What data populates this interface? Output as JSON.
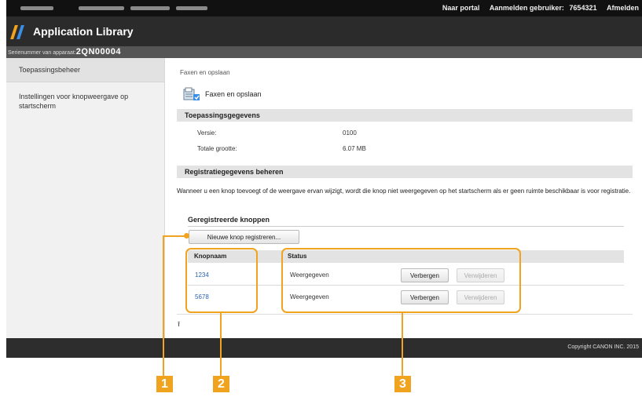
{
  "topbar": {
    "portal_link": "Naar portal",
    "login_user_label": "Aanmelden gebruiker:",
    "login_user_value": "7654321",
    "logout_link": "Afmelden"
  },
  "app": {
    "title": "Application Library"
  },
  "serial": {
    "label": "Serienummer van apparaat:",
    "value": "2QN00004"
  },
  "sidebar": {
    "items": [
      {
        "label": "Toepassingsbeheer"
      },
      {
        "label": "Instellingen voor knopweergave op startscherm"
      }
    ]
  },
  "main": {
    "breadcrumb": "Faxen en opslaan",
    "page_title": "Faxen en opslaan",
    "app_info": {
      "header": "Toepassingsgegevens",
      "version_label": "Versie:",
      "version_value": "0100",
      "size_label": "Totale grootte:",
      "size_value": "6.07 MB"
    },
    "registration": {
      "header": "Registratiegegevens beheren",
      "notice": "Wanneer u een knop toevoegt of de weergave ervan wijzigt, wordt die knop niet weergegeven op het startscherm als er geen ruimte beschikbaar is voor registratie.",
      "registered_title": "Geregistreerde knoppen",
      "new_button": "Nieuwe knop registreren...",
      "columns": {
        "name": "Knopnaam",
        "status": "Status"
      },
      "rows": [
        {
          "name": "1234",
          "status": "Weergegeven",
          "hide": "Verbergen",
          "delete": "Verwijderen"
        },
        {
          "name": "5678",
          "status": "Weergegeven",
          "hide": "Verbergen",
          "delete": "Verwijderen"
        }
      ]
    },
    "to_top": "⭱"
  },
  "footer": {
    "copyright": "Copyright CANON INC. 2015"
  },
  "callouts": [
    "1",
    "2",
    "3"
  ],
  "colors": {
    "accent": "#f0a31f",
    "link": "#2a62b3",
    "logo_orange": "#f0a31f",
    "logo_blue": "#3a8ee6"
  }
}
